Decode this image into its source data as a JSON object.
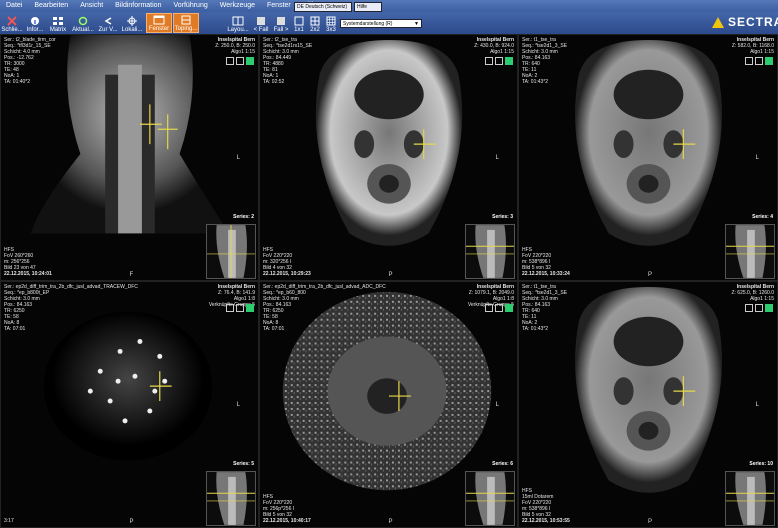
{
  "menu": [
    "Datei",
    "Bearbeiten",
    "Ansicht",
    "Bildinformation",
    "Vorführung",
    "Werkzeuge",
    "Fenster",
    "Hilfe"
  ],
  "language": "DE Deutsch (Schweiz)",
  "help_tag": "Hilfe",
  "toolbar": {
    "buttons": [
      "Schlie...",
      "Infor...",
      "Matrix",
      "Aktual...",
      "Zur V...",
      "Lokali...",
      "Fenster",
      "Toping..."
    ],
    "right_buttons": [
      "Layou...",
      "< Fall",
      "Fall >",
      "1x1",
      "2x2",
      "3x3"
    ],
    "preset": "Systemdarstellung (R)"
  },
  "logo": "SECTRA",
  "hospital": "Inselspital Bern",
  "viewports": [
    {
      "tl": [
        "Ser.: t2_blade_tirm_cor",
        "Seq.: *tfl3d1r_15_SE",
        "Schicht: 4.0 mm",
        "Pos.: -12.762",
        "TR: 3000",
        "TE: 48",
        "NoA: 1",
        "TA: 01:40*2"
      ],
      "tr": [
        "Z: 250.0, B: 250.0",
        "Algo1 1:15"
      ],
      "series": "Series: 2",
      "bl": [
        "HFS",
        "FoV 260*260",
        "m: 256*256",
        "Bild 23 von 47",
        "22.12.2015, 10:24:01"
      ],
      "bottom": "F"
    },
    {
      "tl": [
        "Ser.: t2_tse_tra",
        "Seq.: *tse2d1rs15_SE",
        "Schicht: 3.0 mm",
        "Pos.: 84.449",
        "TR: 4880",
        "TE: 81",
        "NoA: 1",
        "TA: 02:52"
      ],
      "tr": [
        "Z: 430.0, B: 924.0",
        "Algo1 1:15"
      ],
      "series": "Series: 3",
      "bl": [
        "HFS",
        "FoV 220*220",
        "m: 320*256 I",
        "Bild 4 von 32",
        "22.12.2015, 10:29:23"
      ],
      "bottom": "P"
    },
    {
      "tl": [
        "Ser.: t1_tse_tra",
        "Seq.: *tse2d1_3_SE",
        "Schicht: 3.0 mm",
        "Pos.: 84.163",
        "TR: 640",
        "TE: 11",
        "NoA: 2",
        "TA: 01:43*2"
      ],
      "tr": [
        "Z: 582.0, B: 1168.0",
        "Algo1 1:15"
      ],
      "series": "Series: 4",
      "bl": [
        "HFS",
        "FoV 220*220",
        "m: 538*896 I",
        "Bild 5 von 32",
        "22.12.2015, 10:33:24"
      ],
      "bottom": "P"
    },
    {
      "tl": [
        "Ser.: ep2d_diff_trim_tra_2b_dfc_jusl_advad_TRACEW_DFC",
        "Seq.: *ep_b800t_EP",
        "Schicht: 3.0 mm",
        "Pos.: 84.163",
        "TR: 6250",
        "TE: 58",
        "NoA: 8",
        "TA: 07:01"
      ],
      "tr": [
        "Z: 76.4, B: 141.9",
        "Algo1 1:8",
        "Verknüpfte Gruppe 5"
      ],
      "series": "Series: 5",
      "bl": [
        "3:17"
      ],
      "bottom": "P"
    },
    {
      "tl": [
        "Ser.: ep2d_diff_trim_tra_2b_dfc_jusl_advad_ADC_DFC",
        "Seq.: *ep_b60_800",
        "Schicht: 3.0 mm",
        "Pos.: 84.163",
        "TR: 6250",
        "TE: 58",
        "NoA: 8",
        "TA: 07:01"
      ],
      "tr": [
        "Z: 1079.1, B: 2049.0",
        "Algo1 1:8",
        "Verknüpfte Gruppe 5"
      ],
      "series": "Series: 6",
      "bl": [
        "HFS",
        "FoV 220*220",
        "m: 256p*256 I",
        "Bild 5 von 32",
        "22.12.2015, 10:40:17"
      ],
      "bottom": "P"
    },
    {
      "tl": [
        "Ser.: t1_tse_tra",
        "Seq.: *tse2d1_3_SE",
        "Schicht: 3.0 mm",
        "Pos.: 84.163",
        "TR: 640",
        "TE: 11",
        "NoA: 2",
        "TA: 01:43*2"
      ],
      "tr": [
        "Z: 625.0, B: 1260.0",
        "Algo1 1:15"
      ],
      "series": "Series: 10",
      "bl": [
        "HFS",
        "15ml Dotarem",
        "FoV 220*220",
        "m: 538*896 I",
        "Bild 5 von 32",
        "22.12.2015, 10:53:55"
      ],
      "bottom": "P"
    }
  ],
  "colors": {
    "accent": "#e07a25",
    "menubar": "#3c5fa3",
    "crosshair": "#e5d84a"
  }
}
